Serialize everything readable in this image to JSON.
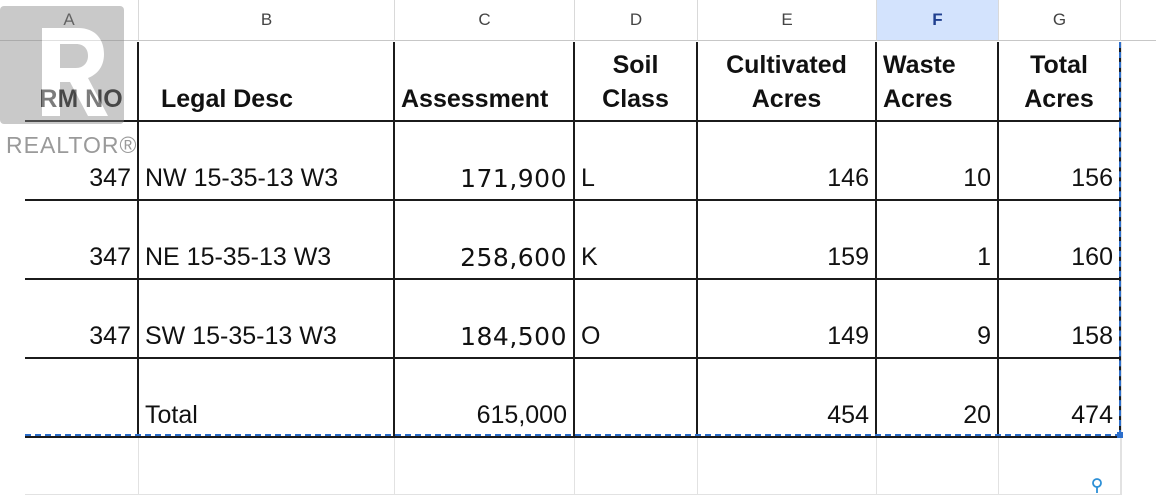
{
  "column_headers": [
    {
      "letter": "A",
      "selected": false
    },
    {
      "letter": "B",
      "selected": false
    },
    {
      "letter": "C",
      "selected": false
    },
    {
      "letter": "D",
      "selected": false
    },
    {
      "letter": "E",
      "selected": false
    },
    {
      "letter": "F",
      "selected": true
    },
    {
      "letter": "G",
      "selected": false
    }
  ],
  "table": {
    "headers": {
      "rm_no": "RM NO",
      "legal_desc": "Legal Desc",
      "assessment": "Assessment",
      "soil_class": "Soil Class",
      "cultivated_acres": "Cultivated Acres",
      "waste_acres": "Waste Acres",
      "total_acres": "Total Acres"
    },
    "rows": [
      {
        "rm_no": "347",
        "legal_desc": "NW 15-35-13 W3",
        "assessment": "171,900",
        "soil_class": "L",
        "cultivated_acres": "146",
        "waste_acres": "10",
        "total_acres": "156"
      },
      {
        "rm_no": "347",
        "legal_desc": "NE 15-35-13 W3",
        "assessment": "258,600",
        "soil_class": "K",
        "cultivated_acres": "159",
        "waste_acres": "1",
        "total_acres": "160"
      },
      {
        "rm_no": "347",
        "legal_desc": "SW 15-35-13 W3",
        "assessment": "184,500",
        "soil_class": "O",
        "cultivated_acres": "149",
        "waste_acres": "9",
        "total_acres": "158"
      }
    ],
    "totals": {
      "label": "Total",
      "assessment": "615,000",
      "cultivated_acres": "454",
      "waste_acres": "20",
      "total_acres": "474"
    }
  },
  "watermark": {
    "text": "REALTOR®",
    "icon": "realtor-logo-icon"
  },
  "colors": {
    "selected_column": "#d3e3fd",
    "selection_border": "#2c6ecb",
    "cell_border": "#1b1b1b"
  }
}
